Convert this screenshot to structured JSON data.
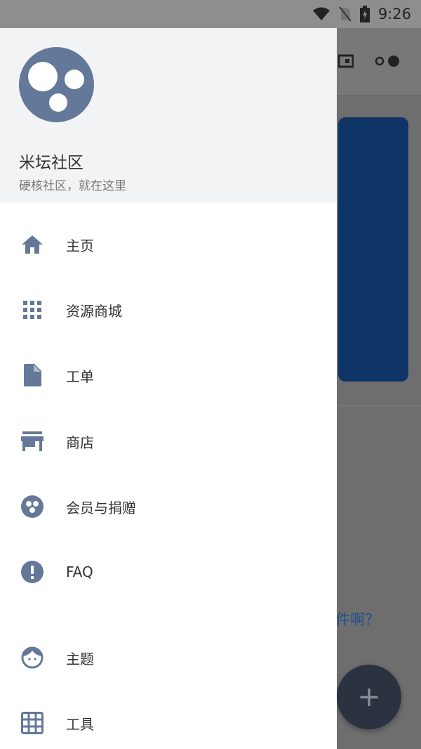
{
  "status_bar": {
    "time": "9:26",
    "icons": [
      "wifi-icon",
      "no-sim-icon",
      "battery-charging-icon"
    ]
  },
  "drawer": {
    "header": {
      "title": "米坛社区",
      "subtitle": "硬核社区，就在这里"
    },
    "items": [
      {
        "label": "主页",
        "icon": "home-icon"
      },
      {
        "label": "资源商城",
        "icon": "apps-grid-icon"
      },
      {
        "label": "工单",
        "icon": "file-icon"
      },
      {
        "label": "商店",
        "icon": "store-icon"
      },
      {
        "label": "会员与捐赠",
        "icon": "membership-icon"
      },
      {
        "label": "FAQ",
        "icon": "alert-circle-icon"
      },
      {
        "label": "主题",
        "icon": "face-icon"
      },
      {
        "label": "工具",
        "icon": "grid-icon"
      }
    ]
  },
  "background": {
    "partial_text": "件啊？",
    "fab_label": "+"
  },
  "colors": {
    "icon": "#64789a",
    "header_bg": "#f2f3f5",
    "card": "#0e3566"
  }
}
